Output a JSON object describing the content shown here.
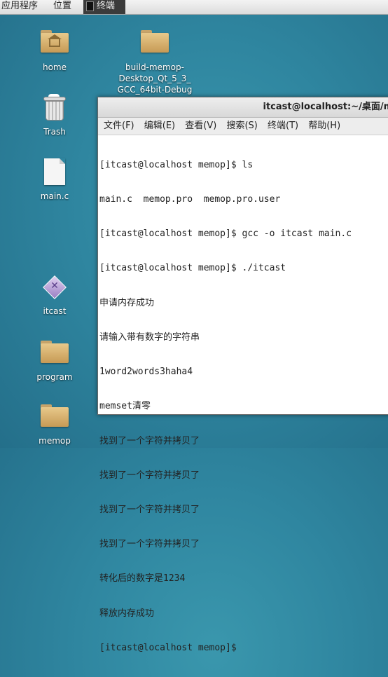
{
  "topbar": {
    "applications": "应用程序",
    "places": "位置",
    "terminal_task": "终端"
  },
  "desktop": {
    "icons": [
      {
        "label": "home",
        "icon": "home-folder-icon"
      },
      {
        "label": "build-memop-\nDesktop_Qt_5_3_\nGCC_64bit-Debug",
        "icon": "folder-icon"
      },
      {
        "label": "Trash",
        "icon": "trash-icon"
      },
      {
        "label": "main.c",
        "icon": "text-file-icon"
      },
      {
        "label": "itcast",
        "icon": "executable-icon"
      },
      {
        "label": "program",
        "icon": "folder-icon"
      },
      {
        "label": "memop",
        "icon": "folder-icon"
      }
    ]
  },
  "terminal": {
    "title": "itcast@localhost:~/桌面/me",
    "menu": [
      "文件(F)",
      "编辑(E)",
      "查看(V)",
      "搜索(S)",
      "终端(T)",
      "帮助(H)"
    ],
    "lines": [
      "[itcast@localhost memop]$ ls",
      "main.c  memop.pro  memop.pro.user",
      "[itcast@localhost memop]$ gcc -o itcast main.c",
      "[itcast@localhost memop]$ ./itcast",
      "申请内存成功",
      "请输入带有数字的字符串",
      "1word2words3haha4",
      "memset清零",
      "找到了一个字符并拷贝了",
      "找到了一个字符并拷贝了",
      "找到了一个字符并拷贝了",
      "找到了一个字符并拷贝了",
      "转化后的数字是1234",
      "释放内存成功",
      "[itcast@localhost memop]$ "
    ]
  }
}
